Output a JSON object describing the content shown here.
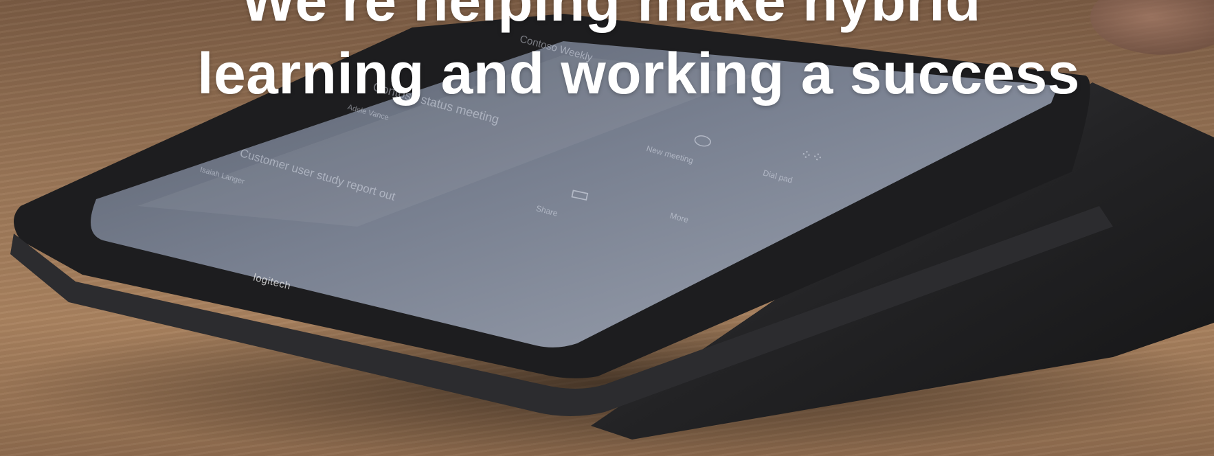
{
  "hero": {
    "headline_line1": "We're helping make hybrid",
    "headline_line2": "learning and working a success"
  },
  "device": {
    "brand_mark": "logitech",
    "screen": {
      "card_title": "Contoso Weekly",
      "meeting_1": "Contoso status meeting",
      "meeting_1_sub": "Adele Vance",
      "meeting_2": "Customer user study report out",
      "meeting_2_sub": "Isaiah Langer",
      "new_meeting_label": "New meeting",
      "dial_pad_label": "Dial pad",
      "share_label": "Share",
      "more_label": "More"
    }
  },
  "colors": {
    "headline": "#ffffff",
    "table": "#a9825f",
    "device_body": "#2a2a2c",
    "screen": "#8e96a6"
  },
  "icons": [
    "meeting-icon",
    "dial-pad-icon",
    "share-screen-icon"
  ]
}
